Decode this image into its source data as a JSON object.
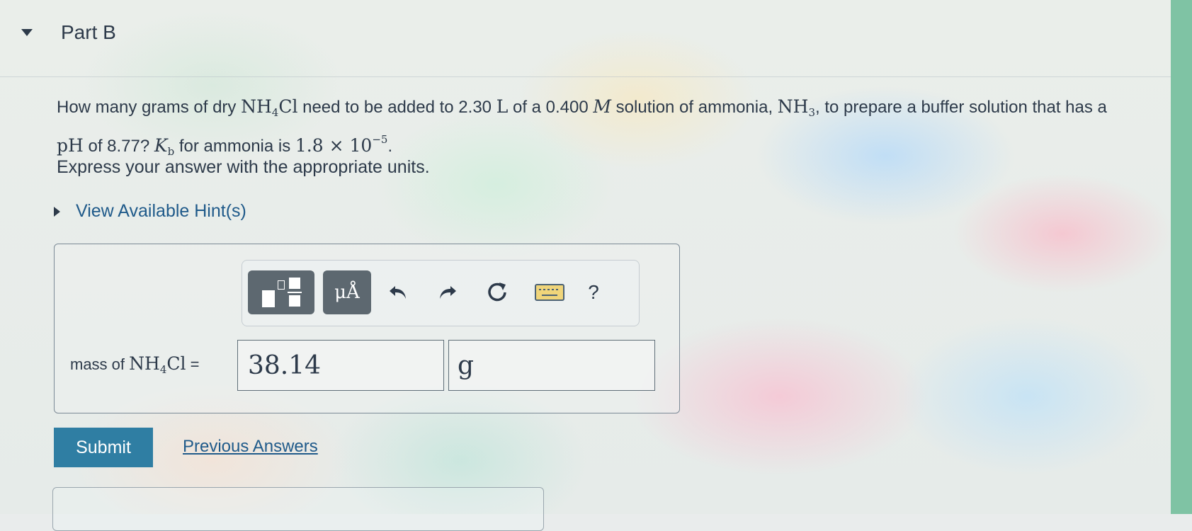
{
  "part": {
    "title": "Part B"
  },
  "question": {
    "seg1": "How many grams of dry ",
    "compound_main": "NH",
    "compound_sub": "4",
    "compound_end": "Cl",
    "seg2": " need to be added to 2.30 ",
    "liter_unit": "L",
    "seg3": " of a 0.400 ",
    "molar_unit": "M",
    "seg4": " solution of ammonia, ",
    "ammonia_main": "NH",
    "ammonia_sub": "3",
    "seg5": ", to prepare a buffer solution that has a ",
    "ph_symbol": "pH",
    "seg6": " of 8.77? ",
    "kb_main": "K",
    "kb_sub": "b",
    "seg7": " for ammonia is ",
    "kb_value": "1.8 × 10",
    "kb_exp": "−5",
    "seg8": "."
  },
  "instruction": "Express your answer with the appropriate units.",
  "hints": {
    "label": "View Available Hint(s)"
  },
  "toolbar": {
    "templates_icon": "templates-icon",
    "units_label": "μÅ",
    "undo_icon": "undo-icon",
    "redo_icon": "redo-icon",
    "reset_icon": "reset-icon",
    "keyboard_icon": "keyboard-icon",
    "help_label": "?"
  },
  "answer": {
    "label_prefix": "mass of ",
    "label_main": "NH",
    "label_sub": "4",
    "label_end": "Cl",
    "label_eq": " =",
    "value": "38.14",
    "unit": "g"
  },
  "actions": {
    "submit_label": "Submit",
    "previous_answers_label": "Previous Answers"
  },
  "colors": {
    "submit_bg": "#2f7ea3",
    "link": "#1f5a8a",
    "toolbar_button": "#5d6870",
    "text": "#2d3a4a",
    "side_strip": "#7fc3a4"
  }
}
